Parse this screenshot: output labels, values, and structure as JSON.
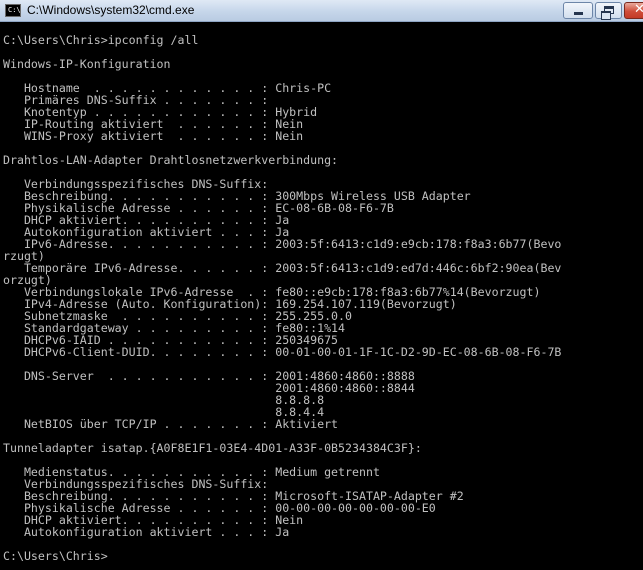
{
  "window": {
    "title": "C:\\Windows\\system32\\cmd.exe",
    "icon": "cmd-icon",
    "buttons": {
      "minimize": "minimize-icon",
      "maximize": "restore-icon",
      "close": "close-icon"
    }
  },
  "console": {
    "text_color": "#c0c0c0",
    "background": "#000000",
    "lines": [
      "C:\\Users\\Chris>ipconfig /all",
      "",
      "Windows-IP-Konfiguration",
      "",
      "   Hostname  . . . . . . . . . . . . : Chris-PC",
      "   Primäres DNS-Suffix . . . . . . . :",
      "   Knotentyp . . . . . . . . . . . . : Hybrid",
      "   IP-Routing aktiviert  . . . . . . : Nein",
      "   WINS-Proxy aktiviert  . . . . . . : Nein",
      "",
      "Drahtlos-LAN-Adapter Drahtlosnetzwerkverbindung:",
      "",
      "   Verbindungsspezifisches DNS-Suffix:",
      "   Beschreibung. . . . . . . . . . . : 300Mbps Wireless USB Adapter",
      "   Physikalische Adresse . . . . . . : EC-08-6B-08-F6-7B",
      "   DHCP aktiviert. . . . . . . . . . : Ja",
      "   Autokonfiguration aktiviert . . . : Ja",
      "   IPv6-Adresse. . . . . . . . . . . : 2003:5f:6413:c1d9:e9cb:178:f8a3:6b77(Bevo",
      "rzugt)",
      "   Temporäre IPv6-Adresse. . . . . . : 2003:5f:6413:c1d9:ed7d:446c:6bf2:90ea(Bev",
      "orzugt)",
      "   Verbindungslokale IPv6-Adresse  . : fe80::e9cb:178:f8a3:6b77%14(Bevorzugt)",
      "   IPv4-Adresse (Auto. Konfiguration): 169.254.107.119(Bevorzugt)",
      "   Subnetzmaske  . . . . . . . . . . : 255.255.0.0",
      "   Standardgateway . . . . . . . . . : fe80::1%14",
      "   DHCPv6-IAID . . . . . . . . . . . : 250349675",
      "   DHCPv6-Client-DUID. . . . . . . . : 00-01-00-01-1F-1C-D2-9D-EC-08-6B-08-F6-7B",
      "",
      "   DNS-Server  . . . . . . . . . . . : 2001:4860:4860::8888",
      "                                       2001:4860:4860::8844",
      "                                       8.8.8.8",
      "                                       8.8.4.4",
      "   NetBIOS über TCP/IP . . . . . . . : Aktiviert",
      "",
      "Tunneladapter isatap.{A0F8E1F1-03E4-4D01-A33F-0B5234384C3F}:",
      "",
      "   Medienstatus. . . . . . . . . . . : Medium getrennt",
      "   Verbindungsspezifisches DNS-Suffix:",
      "   Beschreibung. . . . . . . . . . . : Microsoft-ISATAP-Adapter #2",
      "   Physikalische Adresse . . . . . . : 00-00-00-00-00-00-00-E0",
      "   DHCP aktiviert. . . . . . . . . . : Nein",
      "   Autokonfiguration aktiviert . . . : Ja",
      "",
      "C:\\Users\\Chris>"
    ]
  }
}
